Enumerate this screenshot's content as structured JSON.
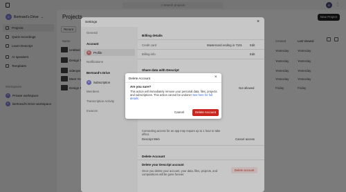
{
  "topbar": {
    "search_placeholder": "Search projects",
    "avatar_initial": "B"
  },
  "sidebar": {
    "workspace_name": "Bertrand's Drive",
    "workspace_initial": "B",
    "items": [
      {
        "label": "Projects",
        "icon": "folder-icon"
      },
      {
        "label": "Quick recordings",
        "icon": "record-icon"
      },
      {
        "label": "Learn Descript",
        "icon": "book-icon"
      },
      {
        "label": "AI speakers",
        "icon": "speaker-icon"
      },
      {
        "label": "Templates",
        "icon": "template-icon"
      }
    ],
    "workspaces_heading": "Workspaces",
    "workspaces": [
      {
        "label": "Private workspace",
        "initial": "P"
      },
      {
        "label": "Bertrand's Drive workspace",
        "initial": "B"
      }
    ]
  },
  "main": {
    "title": "Projects",
    "new_project": "New Project",
    "recent": "Recent",
    "columns": {
      "name": "Name",
      "created": "Created",
      "last_viewed": "Last Viewed"
    },
    "rows": [
      {
        "name": "Untitled",
        "created": "Yesterday",
        "last_viewed": "Yesterday"
      },
      {
        "name": "Design T",
        "created": "Yesterday",
        "last_viewed": "Yesterday"
      },
      {
        "name": "videope",
        "created": "Yesterday",
        "last_viewed": "Yesterday"
      },
      {
        "name": "Meet Yo",
        "created": "Yesterday",
        "last_viewed": "Yesterday"
      },
      {
        "name": "Design F",
        "created": "Friday",
        "last_viewed": "Friday"
      }
    ]
  },
  "settings": {
    "title": "Settings",
    "nav": {
      "general": "General",
      "account_heading": "Account",
      "profile": "Profile",
      "notifications": "Notifications",
      "workspace_heading": "Bertrand's Drive",
      "subscription": "Subscription",
      "members": "Members",
      "transcription_activity": "Transcription Activity",
      "invoices": "Invoices"
    },
    "billing": {
      "heading": "Billing details",
      "credit_card_label": "Credit card",
      "credit_card_value": "Mastercard ending in 7101",
      "billing_info_label": "Billing info",
      "edit": "Edit"
    },
    "share_heading": "Share data with Descript",
    "not_allowed": "Not allowed",
    "apps_text": "Connecting access for an app may require up to 1 hour to take effect.",
    "descript_web_label": "Descript Web",
    "cancel_access": "Cancel access",
    "delete_heading": "Delete Account",
    "delete_sub": "Delete your Descript account",
    "delete_text": "Once you delete your account, your data, files, projects, and compositions will be gone forever.",
    "delete_button": "Delete account"
  },
  "dialog": {
    "title": "Delete Account",
    "question": "Are you sure?",
    "body": "This action will immediately remove your personal data, files, projects and subscriptions. This action cannot be undone!",
    "link": "See here for full details.",
    "cancel": "Cancel",
    "confirm": "Delete Account"
  },
  "colors": {
    "danger": "#c8261f",
    "link": "#2f63d6"
  }
}
